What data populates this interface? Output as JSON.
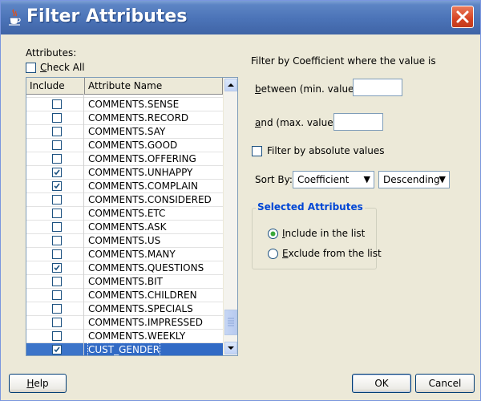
{
  "window": {
    "title": "Filter Attributes"
  },
  "attributes_label": "Attributes:",
  "check_all": {
    "label": "Check All",
    "checked": false
  },
  "table": {
    "columns": [
      "Include",
      "Attribute Name"
    ],
    "rows": [
      {
        "name": "COMMENTS.SENSE",
        "checked": false
      },
      {
        "name": "COMMENTS.RECORD",
        "checked": false
      },
      {
        "name": "COMMENTS.SAY",
        "checked": false
      },
      {
        "name": "COMMENTS.GOOD",
        "checked": false
      },
      {
        "name": "COMMENTS.OFFERING",
        "checked": false
      },
      {
        "name": "COMMENTS.UNHAPPY",
        "checked": true
      },
      {
        "name": "COMMENTS.COMPLAIN",
        "checked": true
      },
      {
        "name": "COMMENTS.CONSIDERED",
        "checked": false
      },
      {
        "name": "COMMENTS.ETC",
        "checked": false
      },
      {
        "name": "COMMENTS.ASK",
        "checked": false
      },
      {
        "name": "COMMENTS.US",
        "checked": false
      },
      {
        "name": "COMMENTS.MANY",
        "checked": false
      },
      {
        "name": "COMMENTS.QUESTIONS",
        "checked": true
      },
      {
        "name": "COMMENTS.BIT",
        "checked": false
      },
      {
        "name": "COMMENTS.CHILDREN",
        "checked": false
      },
      {
        "name": "COMMENTS.SPECIALS",
        "checked": false
      },
      {
        "name": "COMMENTS.IMPRESSED",
        "checked": false
      },
      {
        "name": "COMMENTS.WEEKLY",
        "checked": false
      },
      {
        "name": "CUST_GENDER",
        "checked": true,
        "selected": true
      }
    ]
  },
  "filter": {
    "heading": "Filter by Coefficient where the value is",
    "min_label_u": "b",
    "min_label_rest": "etween (min. value):",
    "min_value": "",
    "max_label_u": "a",
    "max_label_rest": "nd (max. value):",
    "max_value": "",
    "absolute_label": "Filter by absolute values",
    "absolute_checked": false
  },
  "sort": {
    "label": "Sort By:",
    "field": "Coefficient",
    "order": "Descending"
  },
  "selected_attributes": {
    "title": "Selected Attributes",
    "include_u": "I",
    "include_rest": "nclude in the list",
    "exclude_u": "E",
    "exclude_rest": "xclude from the list",
    "selected": "include"
  },
  "buttons": {
    "help_u": "H",
    "help_rest": "elp",
    "ok": "OK",
    "cancel": "Cancel"
  }
}
